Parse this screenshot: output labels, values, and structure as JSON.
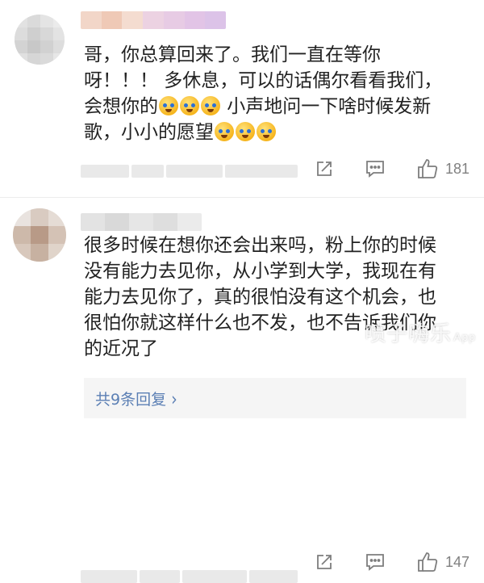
{
  "comments": [
    {
      "text_segments": [
        "哥，你总算回来了。我们一直在等你\n呀！！！ 多休息，可以的话偶尔看看我们，\n会想你的",
        " 小声地问一下啥时候发新\n歌，小小的愿望"
      ],
      "like_count": "181",
      "icons": [
        "share-icon",
        "comment-icon",
        "like-icon"
      ]
    },
    {
      "text": "很多时候在想你还会出来吗，粉上你的时候\n没有能力去见你，从小学到大学，我现在有\n能力去见你了，真的很怕没有这个机会，也\n很怕你就这样什么也不发，也不告诉我们你\n的近况了",
      "replies_label": "共9条回复",
      "like_count": "147",
      "icons": [
        "share-icon",
        "comment-icon",
        "like-icon",
        "chevron-right-icon"
      ]
    }
  ],
  "watermark": {
    "text": "喷子嗨乐",
    "sub": "App"
  },
  "colors": {
    "link": "#5b7fb4",
    "reply_bg": "#f5f5f5",
    "text": "#222222",
    "meta": "#808080"
  }
}
